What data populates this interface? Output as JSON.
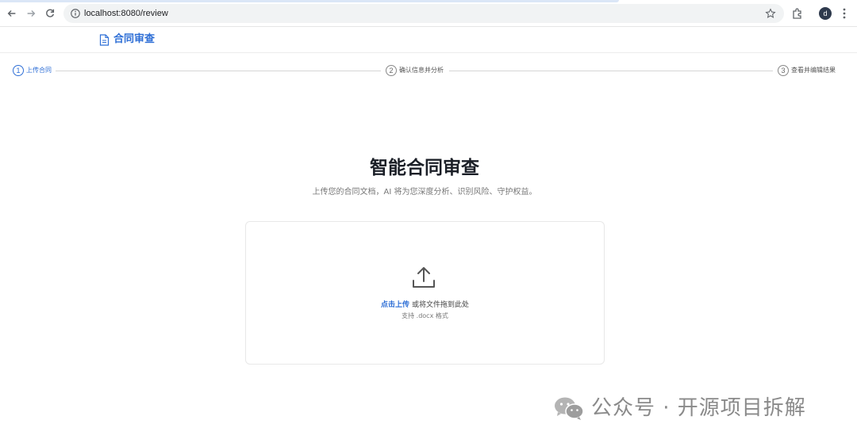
{
  "browser": {
    "url": "localhost:8080/review",
    "profile_initial": "d"
  },
  "header": {
    "title": "合同审查"
  },
  "steps": [
    {
      "number": "1",
      "label": "上传合同",
      "active": true
    },
    {
      "number": "2",
      "label": "确认信息并分析",
      "active": false
    },
    {
      "number": "3",
      "label": "查看并编辑结果",
      "active": false
    }
  ],
  "hero": {
    "title": "智能合同审查",
    "subtitle": "上传您的合同文档，AI 将为您深度分析、识别风险、守护权益。"
  },
  "upload": {
    "link_text": "点击上传",
    "text": "或将文件拖到此处",
    "hint": "支持 .docx 格式"
  },
  "watermark": {
    "text": "公众号 · 开源项目拆解"
  },
  "colors": {
    "accent": "#2f6fd6",
    "title": "#1b1f27"
  }
}
